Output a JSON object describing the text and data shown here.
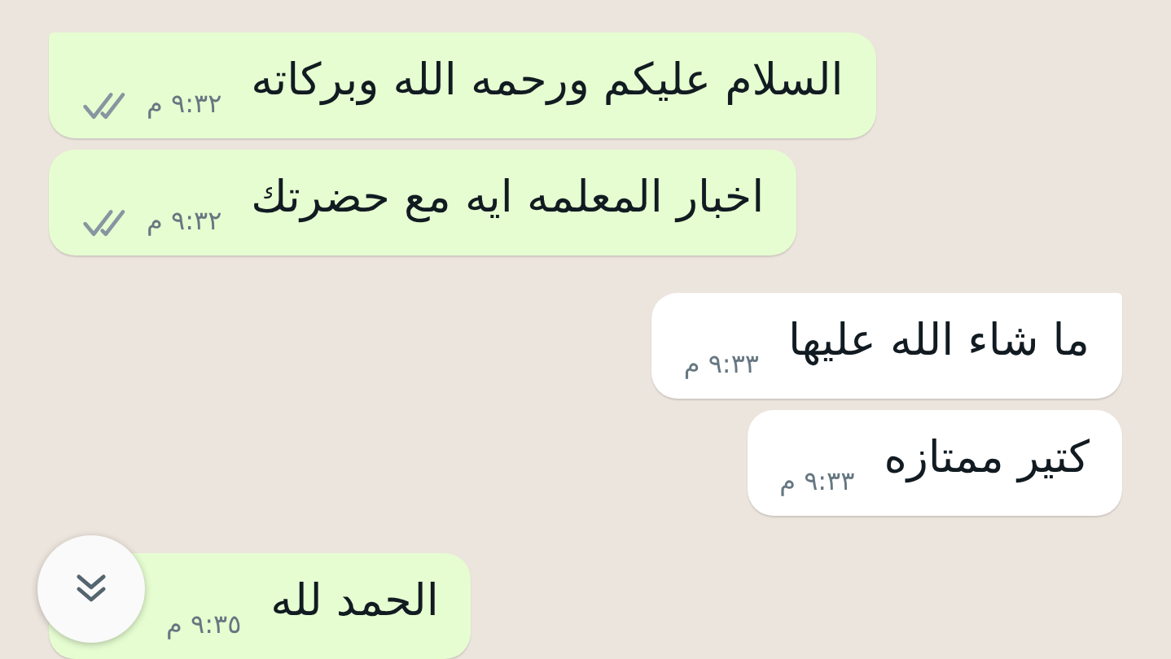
{
  "messages": [
    {
      "outgoing": true,
      "tail": true,
      "text": "السلام عليكم ورحمه الله وبركاته",
      "time": "٩:٣٢ م",
      "ticks": true
    },
    {
      "outgoing": true,
      "tail": false,
      "text": "اخبار المعلمه ايه مع حضرتك",
      "time": "٩:٣٢ م",
      "ticks": true
    },
    {
      "outgoing": false,
      "tail": true,
      "text": "ما شاء الله عليها",
      "time": "٩:٣٣ م",
      "ticks": false
    },
    {
      "outgoing": false,
      "tail": false,
      "text": "كتير ممتازه",
      "time": "٩:٣٣ م",
      "ticks": false
    },
    {
      "outgoing": true,
      "tail": true,
      "text": "الحمد لله",
      "time": "٩:٣٥ م",
      "ticks": false
    }
  ],
  "scroll_button": {
    "visible": true
  }
}
